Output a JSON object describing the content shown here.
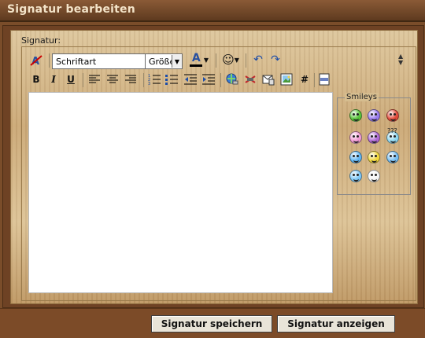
{
  "window": {
    "title": "Signatur bearbeiten"
  },
  "editor": {
    "label": "Signatur:",
    "font_select": "Schriftart",
    "size_select": "Größe",
    "body_text": ""
  },
  "toolbar": {
    "font_color_glyph": "A",
    "bold": "B",
    "italic": "I",
    "underline": "U",
    "hash": "#"
  },
  "smileys": {
    "legend": "Smileys",
    "question_mark_label": "???",
    "items": [
      {
        "name": "grin",
        "color": "#58c43a"
      },
      {
        "name": "sad",
        "color": "#9a7cf0"
      },
      {
        "name": "angry",
        "color": "#e24a3a"
      },
      {
        "name": "tongue",
        "color": "#f19bd4"
      },
      {
        "name": "evil",
        "color": "#b06ad6"
      },
      {
        "name": "confused",
        "color": "#8fd7f0"
      },
      {
        "name": "smile",
        "color": "#61b6f3"
      },
      {
        "name": "wink",
        "color": "#f3d83b"
      },
      {
        "name": "eyes",
        "color": "#78bff3"
      },
      {
        "name": "cool",
        "color": "#7ec8f7"
      },
      {
        "name": "shock",
        "color": "#f5f5f5"
      }
    ]
  },
  "buttons": {
    "save": "Signatur speichern",
    "preview": "Signatur anzeigen"
  },
  "colors": {
    "font_color_bar": "#000000"
  }
}
